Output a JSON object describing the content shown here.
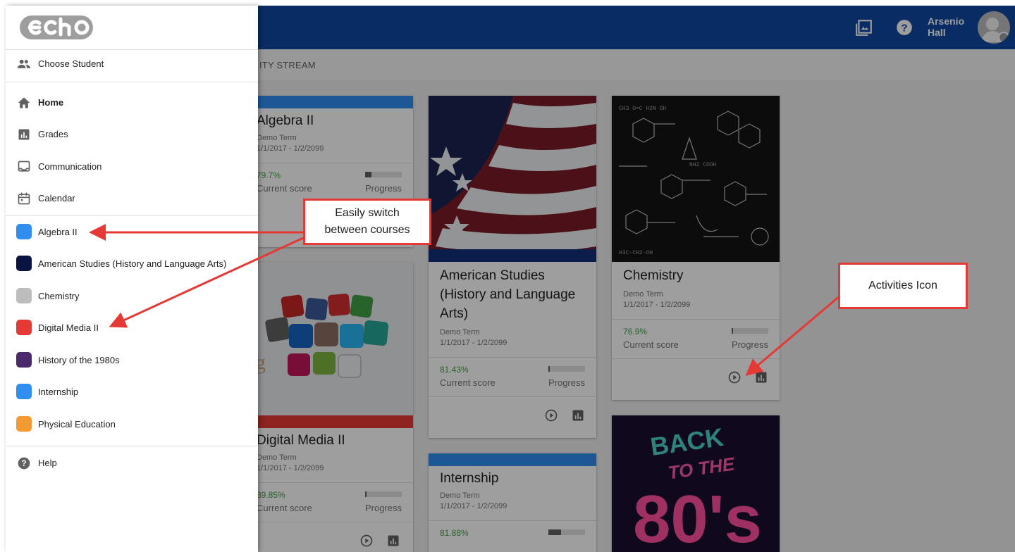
{
  "header": {
    "user_name": "Arsenio Hall",
    "icons": [
      "gallery-icon",
      "help-icon",
      "avatar"
    ]
  },
  "subbar": {
    "tab_label": "ITY STREAM"
  },
  "drawer": {
    "choose_student": "Choose Student",
    "nav": [
      {
        "label": "Home",
        "icon": "home-icon"
      },
      {
        "label": "Grades",
        "icon": "grades-icon"
      },
      {
        "label": "Communication",
        "icon": "communication-icon"
      },
      {
        "label": "Calendar",
        "icon": "calendar-icon"
      }
    ],
    "courses": [
      {
        "label": "Algebra II",
        "color": "#2f8ef0"
      },
      {
        "label": "American Studies (History and Language Arts)",
        "color": "#0a1442"
      },
      {
        "label": "Chemistry",
        "color": "#bdbdbd"
      },
      {
        "label": "Digital Media II",
        "color": "#e53935"
      },
      {
        "label": "History of the 1980s",
        "color": "#4a2a6a"
      },
      {
        "label": "Internship",
        "color": "#2f8ef0"
      },
      {
        "label": "Physical Education",
        "color": "#f39a33"
      }
    ],
    "help": "Help"
  },
  "cards": {
    "algebra": {
      "title": "Algebra II",
      "term": "Demo Term",
      "dates": "1/1/2017 - 1/2/2099",
      "score": "79.7%",
      "score_label": "Current score",
      "progress_label": "Progress",
      "progress": 0.18
    },
    "american": {
      "title_l1": "American Studies",
      "title_l2": "(History and Language",
      "title_l3": "Arts)",
      "term": "Demo Term",
      "dates": "1/1/2017 - 1/2/2099",
      "score": "81.43%",
      "score_label": "Current score",
      "progress_label": "Progress",
      "progress": 0.04
    },
    "chemistry": {
      "title": "Chemistry",
      "term": "Demo Term",
      "dates": "1/1/2017 - 1/2/2099",
      "score": "76.9%",
      "score_label": "Current score",
      "progress_label": "Progress",
      "progress": 0.03
    },
    "digital": {
      "title": "Digital Media II",
      "term": "Demo Term",
      "dates": "1/1/2017 - 1/2/2099",
      "score": "89.85%",
      "score_label": "Current score",
      "progress_label": "Progress",
      "progress": 0.03
    },
    "internship": {
      "title": "Internship",
      "term": "Demo Term",
      "dates": "1/1/2017 - 1/2/2099",
      "score": "81.88%",
      "progress": 0.35
    },
    "eighties": {
      "art_line1": "BACK",
      "art_line2": "TO THE",
      "art_line3": "80's"
    }
  },
  "callouts": {
    "switch_l1": "Easily switch",
    "switch_l2": "between courses",
    "activities": "Activities Icon"
  },
  "colors": {
    "header_blue": "#0d47a1",
    "accent_red": "#e53935",
    "score_green": "#43a047"
  }
}
